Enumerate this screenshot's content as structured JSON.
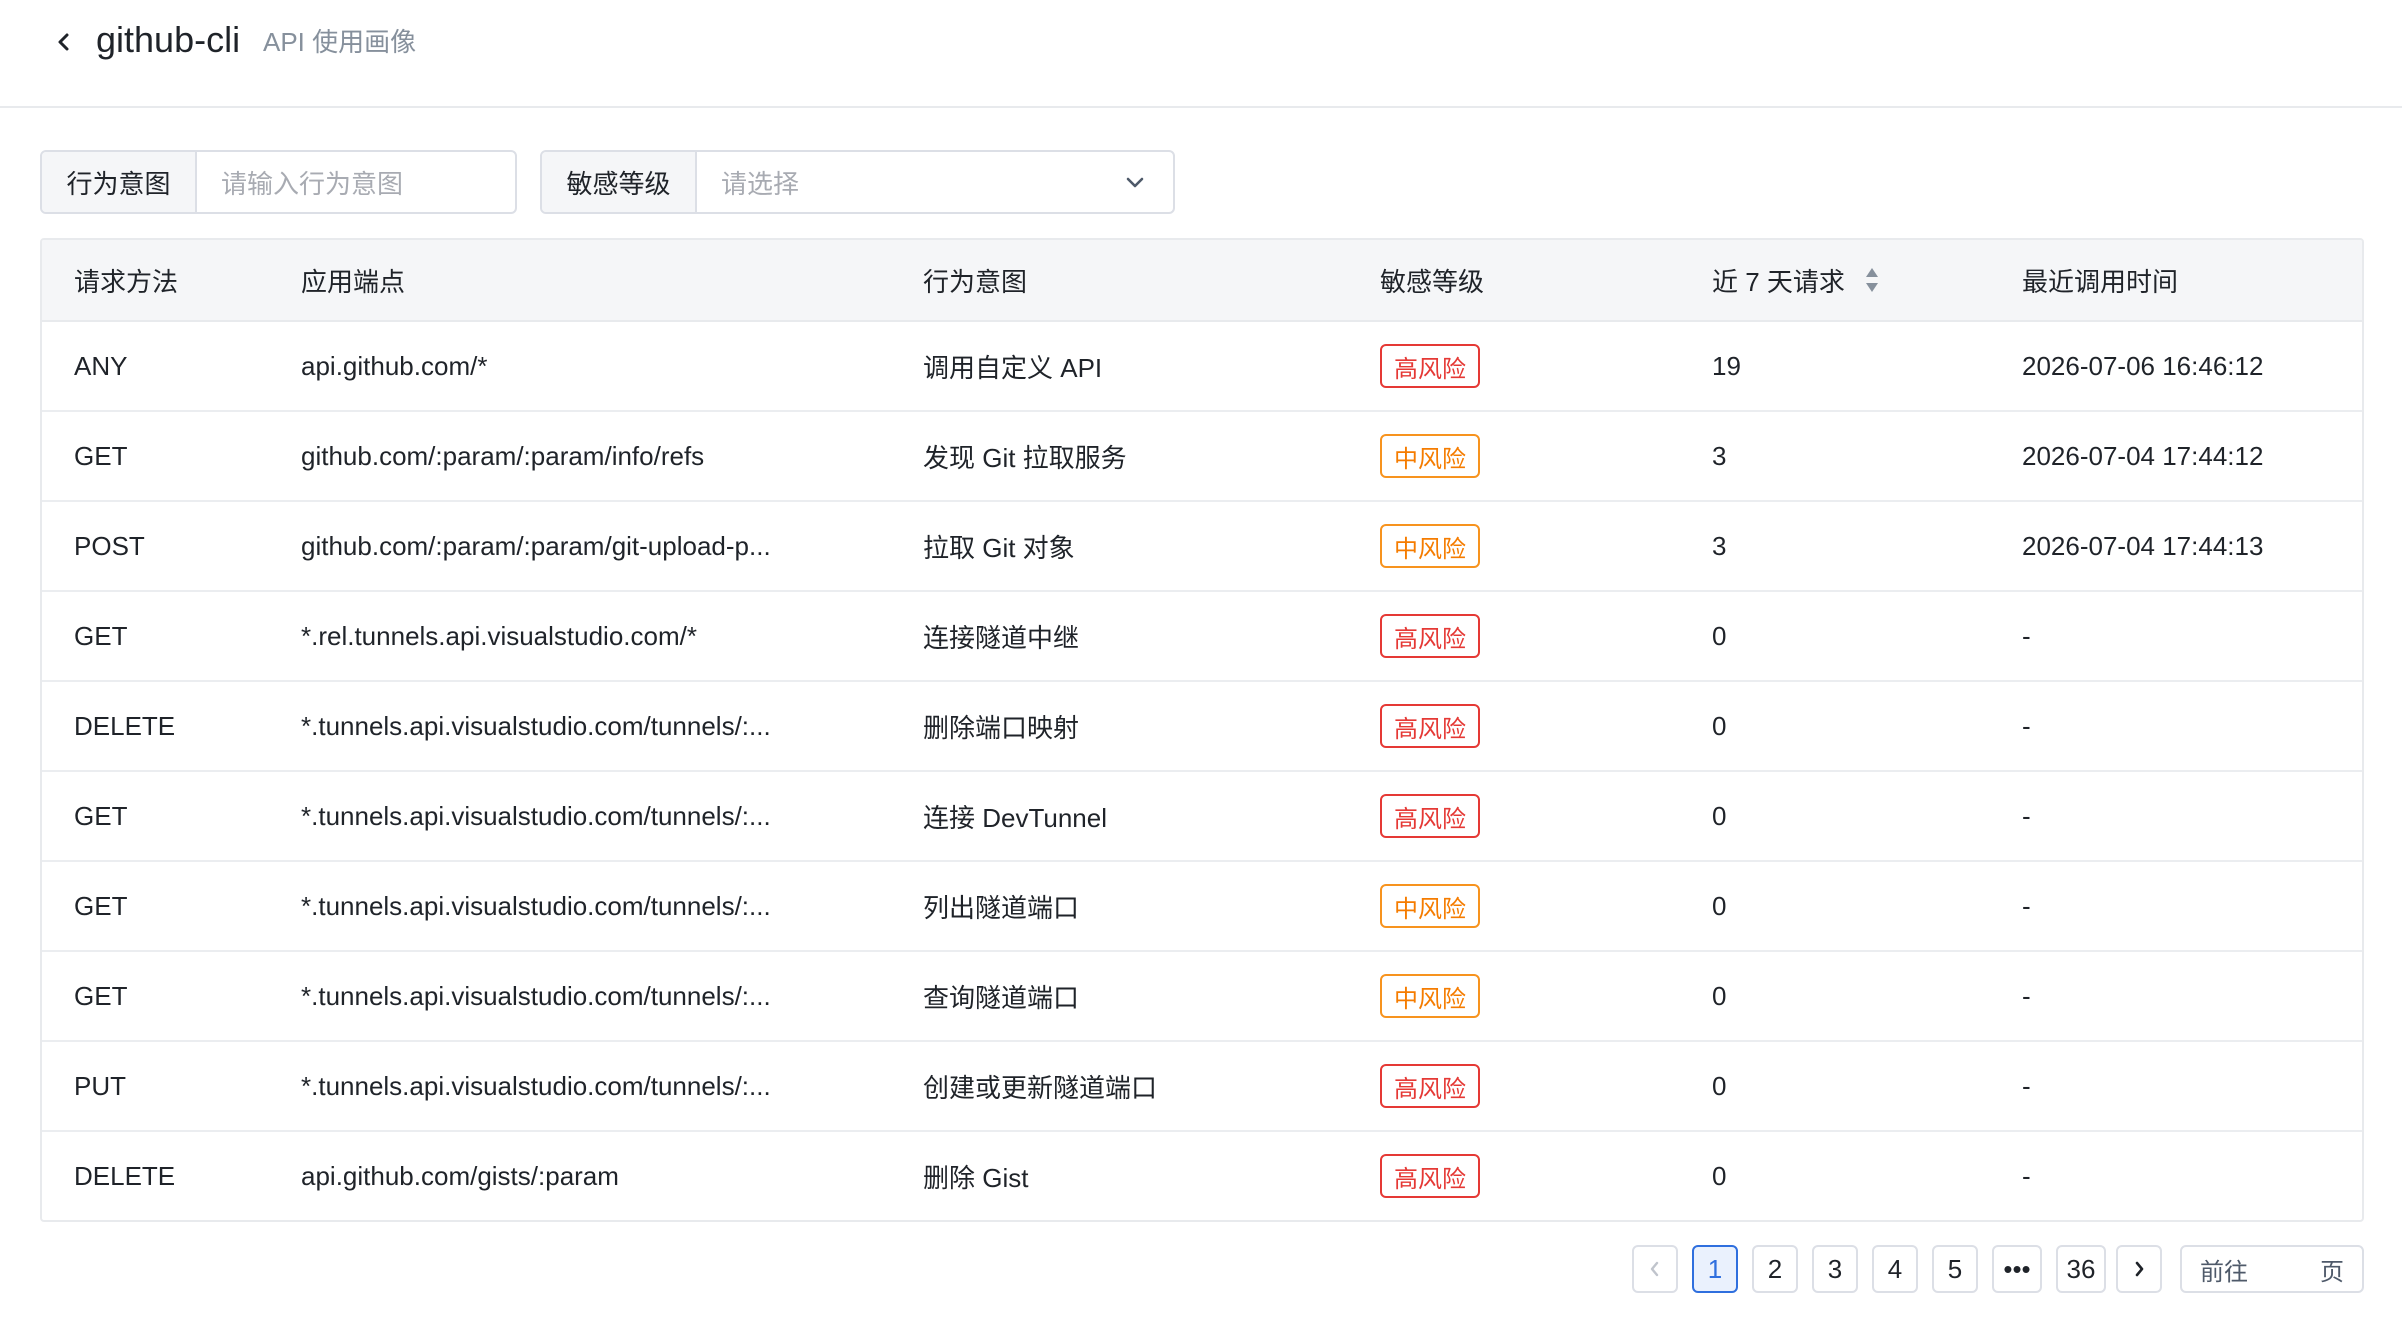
{
  "header": {
    "title": "github-cli",
    "subtitle": "API 使用画像"
  },
  "filters": {
    "intent_label": "行为意图",
    "intent_placeholder": "请输入行为意图",
    "level_label": "敏感等级",
    "level_placeholder": "请选择"
  },
  "table": {
    "columns": {
      "method": "请求方法",
      "endpoint": "应用端点",
      "intent": "行为意图",
      "level": "敏感等级",
      "count": "近 7 天请求",
      "time": "最近调用时间"
    },
    "rows": [
      {
        "method": "ANY",
        "endpoint": "api.github.com/*",
        "intent": "调用自定义 API",
        "level": "高风险",
        "level_type": "high",
        "count": "19",
        "time": "2026-07-06 16:46:12"
      },
      {
        "method": "GET",
        "endpoint": "github.com/:param/:param/info/refs",
        "intent": "发现 Git 拉取服务",
        "level": "中风险",
        "level_type": "mid",
        "count": "3",
        "time": "2026-07-04 17:44:12"
      },
      {
        "method": "POST",
        "endpoint": "github.com/:param/:param/git-upload-p...",
        "intent": "拉取 Git 对象",
        "level": "中风险",
        "level_type": "mid",
        "count": "3",
        "time": "2026-07-04 17:44:13"
      },
      {
        "method": "GET",
        "endpoint": "*.rel.tunnels.api.visualstudio.com/*",
        "intent": "连接隧道中继",
        "level": "高风险",
        "level_type": "high",
        "count": "0",
        "time": "-"
      },
      {
        "method": "DELETE",
        "endpoint": "*.tunnels.api.visualstudio.com/tunnels/:...",
        "intent": "删除端口映射",
        "level": "高风险",
        "level_type": "high",
        "count": "0",
        "time": "-"
      },
      {
        "method": "GET",
        "endpoint": "*.tunnels.api.visualstudio.com/tunnels/:...",
        "intent": "连接 DevTunnel",
        "level": "高风险",
        "level_type": "high",
        "count": "0",
        "time": "-"
      },
      {
        "method": "GET",
        "endpoint": "*.tunnels.api.visualstudio.com/tunnels/:...",
        "intent": "列出隧道端口",
        "level": "中风险",
        "level_type": "mid",
        "count": "0",
        "time": "-"
      },
      {
        "method": "GET",
        "endpoint": "*.tunnels.api.visualstudio.com/tunnels/:...",
        "intent": "查询隧道端口",
        "level": "中风险",
        "level_type": "mid",
        "count": "0",
        "time": "-"
      },
      {
        "method": "PUT",
        "endpoint": "*.tunnels.api.visualstudio.com/tunnels/:...",
        "intent": "创建或更新隧道端口",
        "level": "高风险",
        "level_type": "high",
        "count": "0",
        "time": "-"
      },
      {
        "method": "DELETE",
        "endpoint": "api.github.com/gists/:param",
        "intent": "删除 Gist",
        "level": "高风险",
        "level_type": "high",
        "count": "0",
        "time": "-"
      }
    ]
  },
  "pagination": {
    "pages": [
      "1",
      "2",
      "3",
      "4",
      "5",
      "•••",
      "36"
    ],
    "current": "1",
    "goto_prefix": "前往",
    "goto_suffix": "页"
  },
  "colors": {
    "high": "#e53935",
    "mid": "#f57c00",
    "accent": "#2f6fde"
  }
}
